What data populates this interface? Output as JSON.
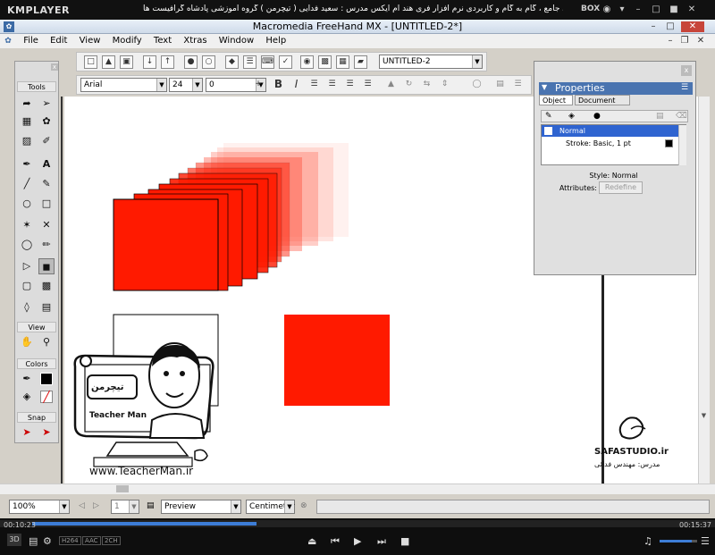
{
  "player": {
    "logo": "KMPLAYER",
    "title": "مجموعه آموزشی جامع ، گام به گام و کاربردی نرم افزار فری هند ام ایکس   مدرس : سعید فدایی ( تیچرمن ) گروه آموزشی پادشاه گرافیست ها",
    "box_label": "BOX",
    "time_elapsed": "00:10:23",
    "time_total": "00:15:37",
    "badges": [
      "H264",
      "AAC",
      "2CH"
    ],
    "seek_progress": 0.664
  },
  "app": {
    "title": "Macromedia FreeHand MX - [UNTITLED-2*]",
    "menu": [
      "File",
      "Edit",
      "View",
      "Modify",
      "Text",
      "Xtras",
      "Window",
      "Help"
    ]
  },
  "toolbar": {
    "document_select": "UNTITLED-2",
    "font_name": "Arial",
    "font_size": "24",
    "leading": "0",
    "bold_label": "B",
    "italic_label": "I"
  },
  "tools": {
    "title": "Tools",
    "sections": {
      "view": "View",
      "colors": "Colors",
      "snap": "Snap"
    },
    "close_label": "x"
  },
  "properties": {
    "title": "Properties",
    "tabs": [
      "Object",
      "Document"
    ],
    "list": {
      "row1": "Normal",
      "row2": "Stroke: Basic, 1 pt"
    },
    "style_text": "Style: Normal",
    "attributes_label": "Attributes:",
    "attributes_button": "Redefine",
    "close_label": "x"
  },
  "status": {
    "zoom": "100%",
    "page": "1",
    "preview": "Preview",
    "units": "Centimeter"
  },
  "watermark": {
    "site": "www.TeacherMan.ir",
    "brand": "Teacher Man",
    "studio": "SAFASTUDIO.ir",
    "studio_caption": "مدرس: مهندس فدائی",
    "tm_persian": "تیچرمن"
  },
  "colors": {
    "red": "#ff1a00",
    "selection": "#2f64d0"
  }
}
